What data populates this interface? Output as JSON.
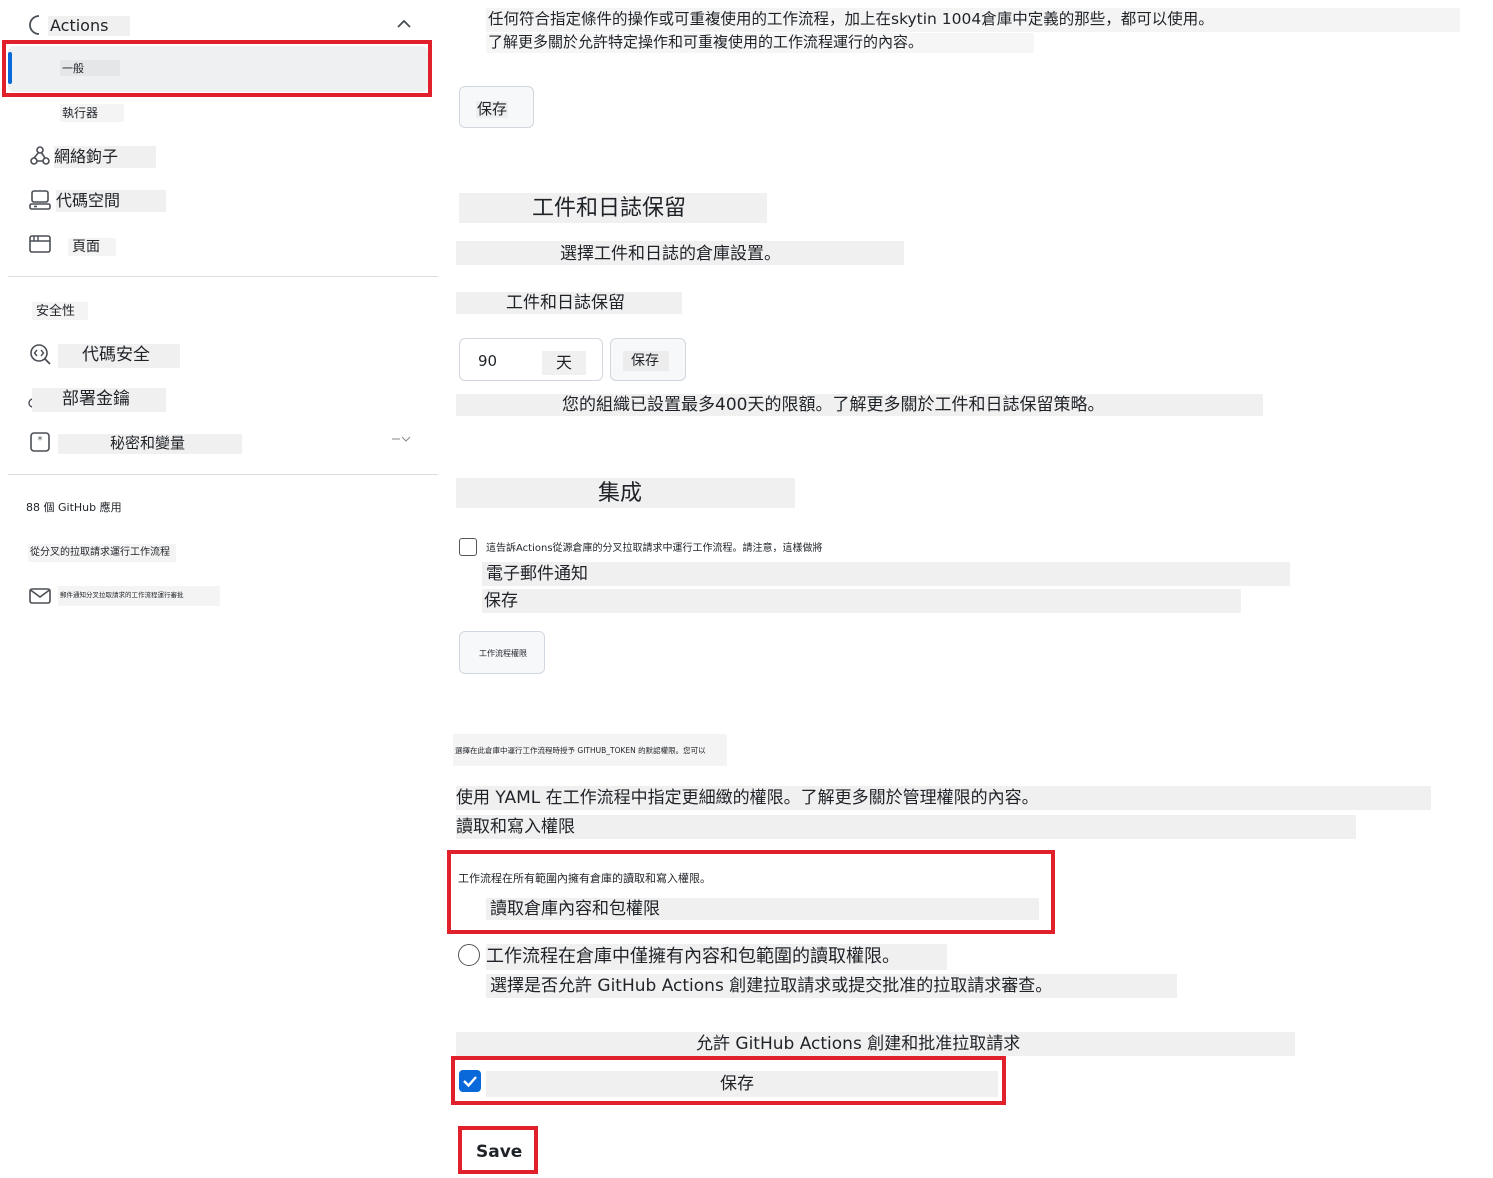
{
  "sidebar": {
    "actions_label": "Actions",
    "items": {
      "general": "一般",
      "runners": "執行器",
      "webhooks": "網絡鉤子",
      "codespaces": "代碼空間",
      "pages": "頁面"
    },
    "security_heading": "安全性",
    "security_items": {
      "code_security": "代碼安全",
      "deploy_keys": "部署金鑰",
      "secrets": "秘密和變量"
    },
    "integrations": {
      "github_apps": "88 個 GitHub 應用",
      "fork_workflows": "從分叉的拉取請求運行工作流程",
      "email_notifications": "郵件通知分叉拉取請求的工作流程運行審批"
    }
  },
  "main": {
    "intro_line1": "任何符合指定條件的操作或可重複使用的工作流程，加上在skytin 1004倉庫中定義的那些，都可以使用。",
    "intro_line2": "了解更多關於允許特定操作和可重複使用的工作流程運行的內容。",
    "save_label": "保存",
    "artifacts": {
      "heading": "工件和日誌保留",
      "desc": "選擇工件和日誌的倉庫設置。",
      "field_label": "工件和日誌保留",
      "days_value": "90",
      "days_unit": "天",
      "save_label": "保存",
      "limit_note": "您的組織已設置最多400天的限額。了解更多關於工件和日誌保留策略。"
    },
    "integration": {
      "heading": "集成",
      "checkbox_label": "這告訴Actions從源倉庫的分叉拉取請求中運行工作流程。請注意，這樣做將",
      "email_label": "電子郵件通知",
      "save_text": "保存",
      "workflow_button": "工作流程權限"
    },
    "permissions": {
      "token_desc": "選擇在此倉庫中運行工作流程時授予 GITHUB_TOKEN 的默認權限。您可以",
      "yaml_desc": "使用 YAML 在工作流程中指定更細緻的權限。了解更多關於管理權限的內容。",
      "read_write_label": "讀取和寫入權限",
      "read_write_desc": "工作流程在所有範圍內擁有倉庫的讀取和寫入權限。",
      "read_only_label": "讀取倉庫內容和包權限",
      "read_only_desc": "工作流程在倉庫中僅擁有內容和包範圍的讀取權限。",
      "pr_desc": "選擇是否允許 GitHub Actions 創建拉取請求或提交批准的拉取請求審查。",
      "allow_pr_label": "允許 GitHub Actions 創建和批准拉取請求",
      "checkbox_save": "保存",
      "save_button": "Save"
    }
  },
  "colors": {
    "highlight_red": "#e0202a",
    "accent_blue": "#0969da",
    "label_bg": "#f0f0f0"
  }
}
